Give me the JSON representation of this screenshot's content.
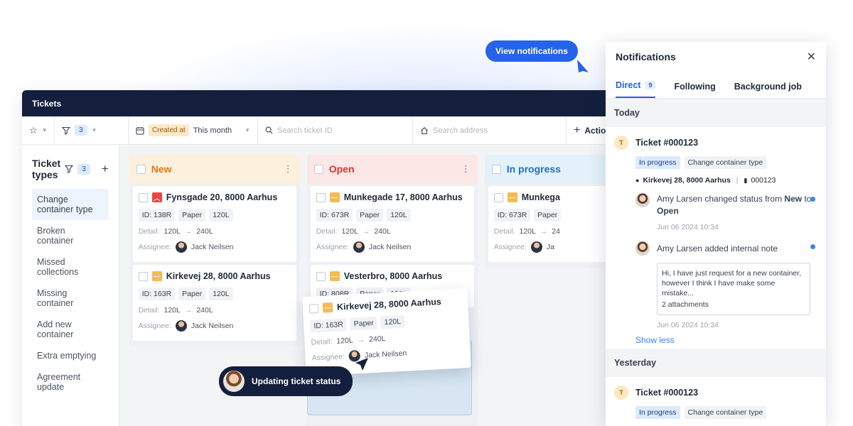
{
  "tooltip": {
    "view_notifications": "View notifications"
  },
  "app": {
    "title": "Tickets",
    "toolbar": {
      "filter_count": "3",
      "date_field": "Created at",
      "date_range": "This month",
      "search_ticket_placeholder": "Search ticket ID",
      "search_address_placeholder": "Search address",
      "actions_label": "Actions"
    },
    "sidebar": {
      "title": "Ticket types",
      "filter_count": "3",
      "items": [
        "Change container type",
        "Broken container",
        "Missed collections",
        "Missing container",
        "Add new container",
        "Extra emptying",
        "Agreement update"
      ]
    },
    "columns": [
      {
        "title": "New",
        "color": "#e8770f",
        "head_bg": "#fdf1dd",
        "cards": [
          {
            "title": "Fynsgade 20, 8000 Aarhus",
            "priority": "high",
            "id": "ID: 138R",
            "material": "Paper",
            "size": "120L",
            "detail_label": "Detail:",
            "detail_from": "120L",
            "detail_to": "240L",
            "assignee_label": "Assignee:",
            "assignee": "Jack Neilsen"
          },
          {
            "title": "Kirkevej 28, 8000 Aarhus",
            "priority": "medium",
            "id": "ID: 163R",
            "material": "Paper",
            "size": "120L",
            "detail_label": "Detail:",
            "detail_from": "120L",
            "detail_to": "240L",
            "assignee_label": "Assignee:",
            "assignee": "Jack Neilsen"
          }
        ]
      },
      {
        "title": "Open",
        "color": "#e3342f",
        "head_bg": "#fce7e7",
        "cards": [
          {
            "title": "Munkegade 17, 8000 Aarhus",
            "priority": "medium",
            "id": "ID: 673R",
            "material": "Paper",
            "size": "120L",
            "detail_label": "Detail:",
            "detail_from": "120L",
            "detail_to": "240L",
            "assignee_label": "Assignee:",
            "assignee": "Jack Neilsen"
          },
          {
            "title": "Vesterbro, 8000 Aarhus",
            "priority": "medium",
            "id": "ID: 808R",
            "material": "Paper",
            "size": "120L"
          }
        ]
      },
      {
        "title": "In progress",
        "color": "#1d6fc4",
        "head_bg": "#e3f1fb",
        "cards": [
          {
            "title": "Munkega",
            "priority": "medium",
            "id": "ID: 673R",
            "material": "Paper",
            "detail_label": "Detail:",
            "detail_from": "120L",
            "detail_to": "24",
            "assignee_label": "Assignee:",
            "assignee": "Ja"
          }
        ]
      }
    ],
    "dragged_card": {
      "title": "Kirkevej 28, 8000 Aarhus",
      "id": "ID: 163R",
      "material": "Paper",
      "size": "120L",
      "detail_label": "Detail:",
      "detail_from": "120L",
      "detail_to": "240L",
      "assignee_label": "Assignee:",
      "assignee": "Jack Neilsen"
    },
    "status_pill": "Updating ticket status"
  },
  "notifications": {
    "title": "Notifications",
    "tabs": [
      {
        "label": "Direct",
        "count": "9"
      },
      {
        "label": "Following"
      },
      {
        "label": "Background job"
      }
    ],
    "today": {
      "heading": "Today",
      "ticket": "Ticket #000123",
      "avatar_letter": "T",
      "status": "In progress",
      "type": "Change container type",
      "address": "Kirkevej 28, 8000 Aarhus",
      "container_id": "000123",
      "activity1_pre": "Amy Larsen changed status from ",
      "activity1_from": "New",
      "activity1_mid": " to ",
      "activity1_to": "Open",
      "activity1_time": "Jun 06 2024 10:34",
      "activity2": "Amy Larsen added internal note",
      "note_text": "Hi, I have just request for a new container, however I think I have make some mistake...",
      "note_attachments": "2 attachments",
      "activity2_time": "Jun 06 2024 10:34",
      "show_less": "Show less"
    },
    "yesterday": {
      "heading": "Yesterday",
      "ticket": "Ticket #000123",
      "avatar_letter": "T",
      "status": "In progress",
      "type": "Change container type"
    }
  }
}
